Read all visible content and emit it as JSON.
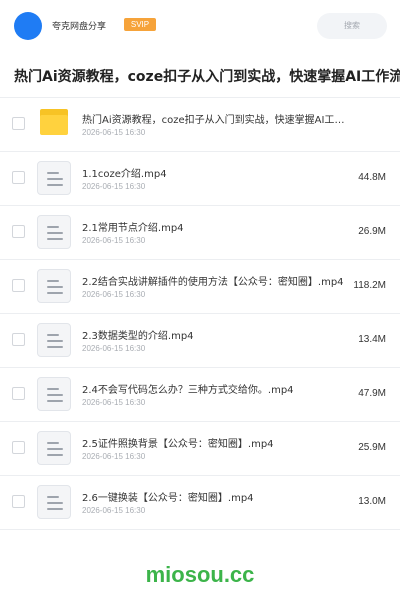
{
  "header": {
    "username": "夸克网盘分享",
    "badge": "SVIP",
    "search_placeholder": "搜索"
  },
  "title": "热门Ai资源教程，coze扣子从入门到实战，快速掌握AI工作流",
  "files": [
    {
      "type": "folder",
      "name": "热门Ai资源教程，coze扣子从入门到实战，快速掌握AI工作流",
      "date": "2026-06-15 16:30",
      "size": ""
    },
    {
      "type": "file",
      "name": "1.1coze介绍.mp4",
      "date": "2026-06-15 16:30",
      "size": "44.8M"
    },
    {
      "type": "file",
      "name": "2.1常用节点介绍.mp4",
      "date": "2026-06-15 16:30",
      "size": "26.9M"
    },
    {
      "type": "file",
      "name": "2.2结合实战讲解插件的使用方法【公众号：密知圈】.mp4",
      "date": "2026-06-15 16:30",
      "size": "118.2M"
    },
    {
      "type": "file",
      "name": "2.3数据类型的介绍.mp4",
      "date": "2026-06-15 16:30",
      "size": "13.4M"
    },
    {
      "type": "file",
      "name": "2.4不会写代码怎么办？三种方式交给你。.mp4",
      "date": "2026-06-15 16:30",
      "size": "47.9M"
    },
    {
      "type": "file",
      "name": "2.5证件照换背景【公众号：密知圈】.mp4",
      "date": "2026-06-15 16:30",
      "size": "25.9M"
    },
    {
      "type": "file",
      "name": "2.6一键换装【公众号：密知圈】.mp4",
      "date": "2026-06-15 16:30",
      "size": "13.0M"
    }
  ],
  "footer": {
    "watermark": "miosou.cc"
  },
  "colors": {
    "accent": "#1f7cf4",
    "badge": "#f6a33a",
    "folder": "#ffd23e",
    "watermark": "#3cb44a"
  }
}
